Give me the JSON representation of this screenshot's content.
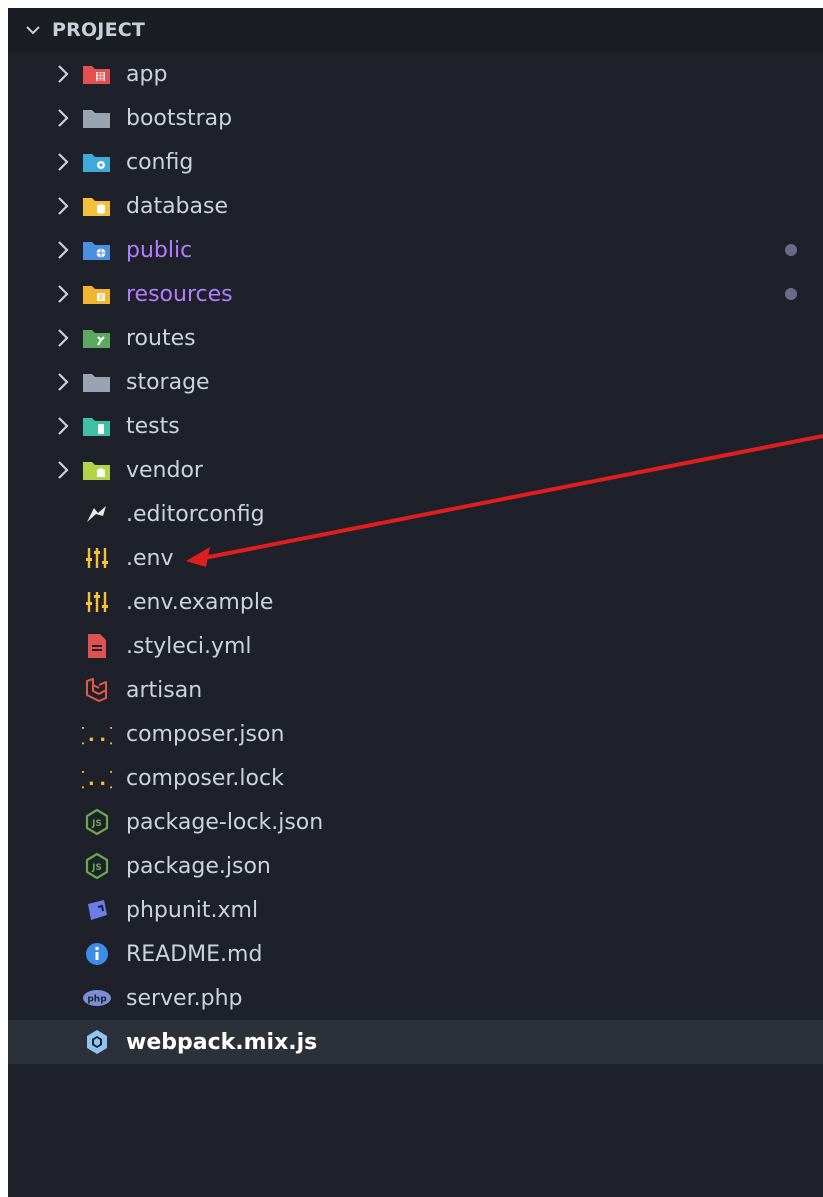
{
  "explorer": {
    "section_title": "PROJECT"
  },
  "folders": [
    {
      "label": "app",
      "icon": "app-folder-icon",
      "color": "#e05252",
      "modified": false
    },
    {
      "label": "bootstrap",
      "icon": "folder-icon",
      "color": "#9aa3b2",
      "modified": false
    },
    {
      "label": "config",
      "icon": "config-folder-icon",
      "color": "#3fa9d8",
      "modified": false
    },
    {
      "label": "database",
      "icon": "database-folder-icon",
      "color": "#f3c23a",
      "modified": false
    },
    {
      "label": "public",
      "icon": "public-folder-icon",
      "color": "#4a8fe0",
      "modified": true
    },
    {
      "label": "resources",
      "icon": "resources-folder-icon",
      "color": "#f3b431",
      "modified": true
    },
    {
      "label": "routes",
      "icon": "routes-folder-icon",
      "color": "#5ba85e",
      "modified": false
    },
    {
      "label": "storage",
      "icon": "folder-icon",
      "color": "#9aa3b2",
      "modified": false
    },
    {
      "label": "tests",
      "icon": "tests-folder-icon",
      "color": "#3fbfa4",
      "modified": false
    },
    {
      "label": "vendor",
      "icon": "vendor-folder-icon",
      "color": "#b3d448",
      "modified": false
    }
  ],
  "files": [
    {
      "label": ".editorconfig",
      "icon": "editorconfig-icon",
      "color": "#e8e8e8"
    },
    {
      "label": ".env",
      "icon": "env-icon",
      "color": "#f3c23a"
    },
    {
      "label": ".env.example",
      "icon": "env-icon",
      "color": "#f3c23a"
    },
    {
      "label": ".styleci.yml",
      "icon": "yaml-icon",
      "color": "#e05252"
    },
    {
      "label": "artisan",
      "icon": "laravel-icon",
      "color": "#e0584a"
    },
    {
      "label": "composer.json",
      "icon": "json-braces-icon",
      "color": "#f3c23a"
    },
    {
      "label": "composer.lock",
      "icon": "json-braces-icon",
      "color": "#f3c23a"
    },
    {
      "label": "package-lock.json",
      "icon": "nodejs-icon",
      "color": "#6aa84f"
    },
    {
      "label": "package.json",
      "icon": "nodejs-icon",
      "color": "#6aa84f"
    },
    {
      "label": "phpunit.xml",
      "icon": "phpunit-icon",
      "color": "#6c7ce8"
    },
    {
      "label": "README.md",
      "icon": "info-icon",
      "color": "#3f8ce8"
    },
    {
      "label": "server.php",
      "icon": "php-icon",
      "color": "#7b8fd8"
    },
    {
      "label": "webpack.mix.js",
      "icon": "webpack-icon",
      "color": "#8ec5f0"
    }
  ],
  "selected_file": "webpack.mix.js",
  "annotation": {
    "color": "#e01e1e",
    "points_to": ".env"
  }
}
